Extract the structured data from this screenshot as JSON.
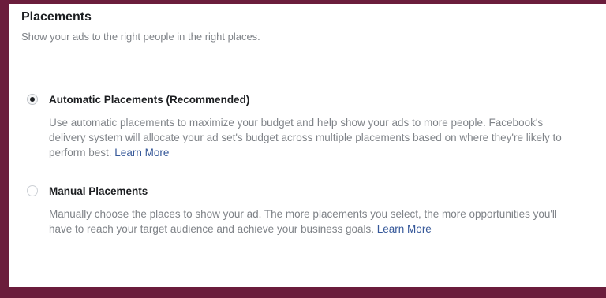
{
  "header": {
    "title": "Placements",
    "subtitle": "Show your ads to the right people in the right places."
  },
  "options": [
    {
      "label": "Automatic Placements (Recommended)",
      "selected": true,
      "description": "Use automatic placements to maximize your budget and help show your ads to more people. Facebook's delivery system will allocate your ad set's budget across multiple placements based on where they're likely to perform best.",
      "link": "Learn More"
    },
    {
      "label": "Manual Placements",
      "selected": false,
      "description": "Manually choose the places to show your ad. The more placements you select, the more opportunities you'll have to reach your target audience and achieve your business goals.",
      "link": "Learn More"
    }
  ],
  "colors": {
    "background_accent": "#6b1d3c",
    "link": "#365899",
    "muted_text": "#7f8388"
  }
}
